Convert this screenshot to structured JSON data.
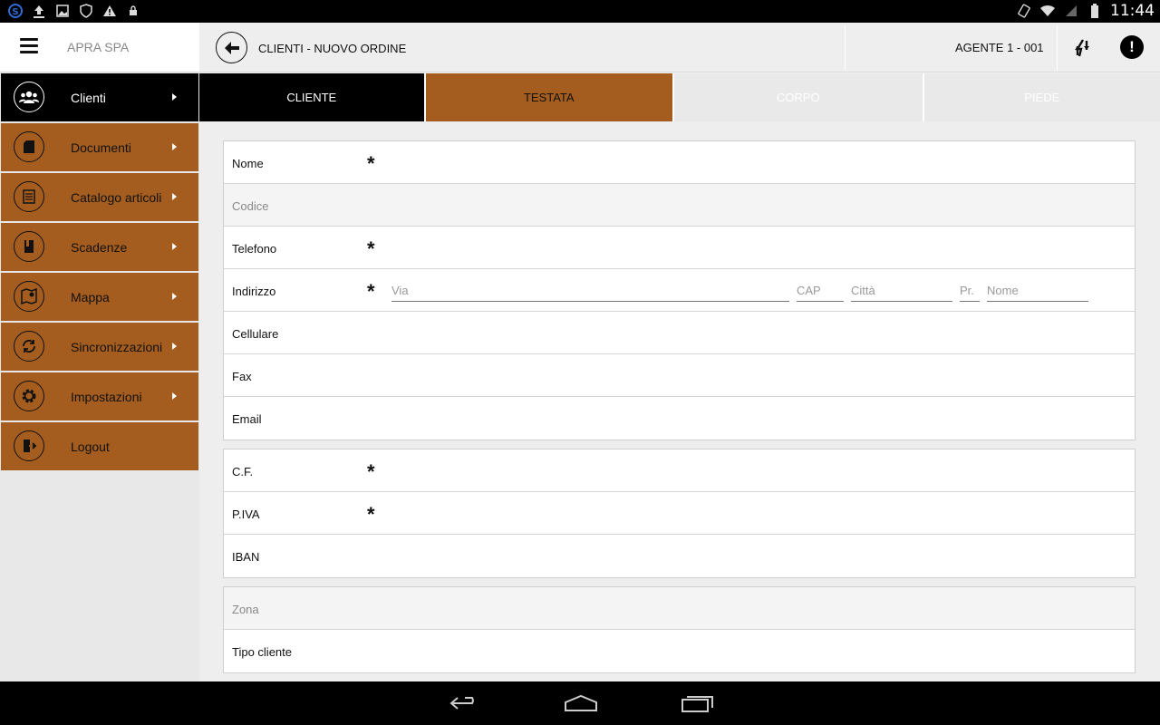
{
  "status_bar": {
    "time": "11:44",
    "icons": [
      "skype-icon",
      "upload-icon",
      "image-icon",
      "shield-icon",
      "warning-icon",
      "lock-icon",
      "rotate-icon",
      "wifi-icon",
      "signal-icon",
      "battery-icon"
    ]
  },
  "sidebar": {
    "company": "APRA SPA",
    "items": [
      {
        "label": "Clienti",
        "icon": "users-icon",
        "active": true
      },
      {
        "label": "Documenti",
        "icon": "document-icon",
        "active": false
      },
      {
        "label": "Catalogo articoli",
        "icon": "catalog-icon",
        "active": false
      },
      {
        "label": "Scadenze",
        "icon": "book-icon",
        "active": false
      },
      {
        "label": "Mappa",
        "icon": "map-icon",
        "active": false
      },
      {
        "label": "Sincronizzazioni",
        "icon": "sync-icon",
        "active": false
      },
      {
        "label": "Impostazioni",
        "icon": "gear-icon",
        "active": false
      },
      {
        "label": "Logout",
        "icon": "logout-icon",
        "active": false
      }
    ]
  },
  "header": {
    "title": "CLIENTI - NUOVO ORDINE",
    "agent": "AGENTE 1 - 001"
  },
  "tabs": [
    {
      "label": "CLIENTE",
      "state": "selected"
    },
    {
      "label": "TESTATA",
      "state": "current"
    },
    {
      "label": "CORPO",
      "state": "disabled"
    },
    {
      "label": "PIEDE",
      "state": "disabled"
    }
  ],
  "form": {
    "section1": [
      {
        "label": "Nome",
        "required": true
      },
      {
        "label": "Codice",
        "required": false,
        "disabled": true
      },
      {
        "label": "Telefono",
        "required": true
      },
      {
        "label": "Indirizzo",
        "required": true
      },
      {
        "label": "Cellulare",
        "required": false
      },
      {
        "label": "Fax",
        "required": false
      },
      {
        "label": "Email",
        "required": false
      }
    ],
    "address_placeholders": {
      "via": "Via",
      "cap": "CAP",
      "citta": "Città",
      "provincia": "Pr.",
      "nome": "Nome"
    },
    "section2": [
      {
        "label": "C.F.",
        "required": true
      },
      {
        "label": "P.IVA",
        "required": true
      },
      {
        "label": "IBAN",
        "required": false
      }
    ],
    "section3": [
      {
        "label": "Zona",
        "required": false,
        "disabled": true
      },
      {
        "label": "Tipo cliente",
        "required": false
      }
    ],
    "required_mark": "*"
  },
  "colors": {
    "accent": "#a45d1e",
    "active": "#000000",
    "background": "#eeeeee"
  }
}
